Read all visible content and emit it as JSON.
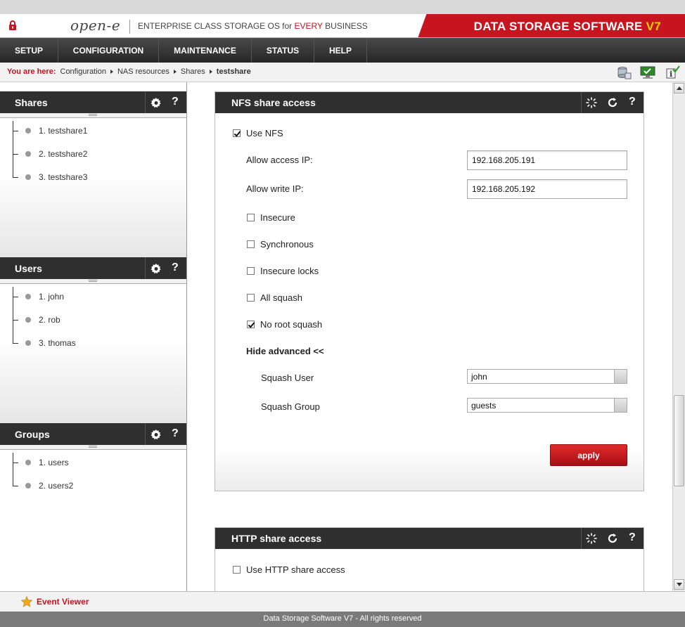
{
  "header": {
    "logo": "open-e",
    "tagline_prefix": "ENTERPRISE CLASS STORAGE OS for ",
    "tagline_highlight": "EVERY",
    "tagline_suffix": " BUSINESS",
    "brand": "DATA STORAGE SOFTWARE ",
    "brand_version": "V7"
  },
  "menu": [
    {
      "label": "SETUP"
    },
    {
      "label": "CONFIGURATION"
    },
    {
      "label": "MAINTENANCE"
    },
    {
      "label": "STATUS"
    },
    {
      "label": "HELP"
    }
  ],
  "breadcrumb": {
    "label": "You are here:",
    "items": [
      "Configuration",
      "NAS resources",
      "Shares"
    ],
    "current": "testshare"
  },
  "sidebar": {
    "shares": {
      "title": "Shares",
      "items": [
        "1. testshare1",
        "2. testshare2",
        "3. testshare3"
      ]
    },
    "users": {
      "title": "Users",
      "items": [
        "1. john",
        "2. rob",
        "3. thomas"
      ]
    },
    "groups": {
      "title": "Groups",
      "items": [
        "1. users",
        "2. users2"
      ]
    }
  },
  "nfs": {
    "title": "NFS share access",
    "use_nfs": {
      "label": "Use NFS",
      "checked": true
    },
    "allow_access_ip": {
      "label": "Allow access IP:",
      "value": "192.168.205.191"
    },
    "allow_write_ip": {
      "label": "Allow write IP:",
      "value": "192.168.205.192"
    },
    "options": [
      {
        "label": "Insecure",
        "checked": false
      },
      {
        "label": "Synchronous",
        "checked": false
      },
      {
        "label": "Insecure locks",
        "checked": false
      },
      {
        "label": "All squash",
        "checked": false
      },
      {
        "label": "No root squash",
        "checked": true
      }
    ],
    "hide_advanced": "Hide advanced <<",
    "squash_user": {
      "label": "Squash User",
      "value": "john"
    },
    "squash_group": {
      "label": "Squash Group",
      "value": "guests"
    },
    "apply": "apply"
  },
  "http": {
    "title": "HTTP share access",
    "use_http": {
      "label": "Use HTTP share access",
      "checked": false
    }
  },
  "footer": {
    "event_viewer": "Event Viewer",
    "copyright": "Data Storage Software V7 - All rights reserved"
  },
  "colors": {
    "brand_red": "#c8141e",
    "version_yellow": "#f5d000",
    "dark_bar": "#2f2f2f"
  },
  "icons": [
    "lock-icon",
    "gear-icon",
    "help-icon",
    "spinner-icon",
    "refresh-icon",
    "star-icon",
    "chevron-right-icon"
  ]
}
